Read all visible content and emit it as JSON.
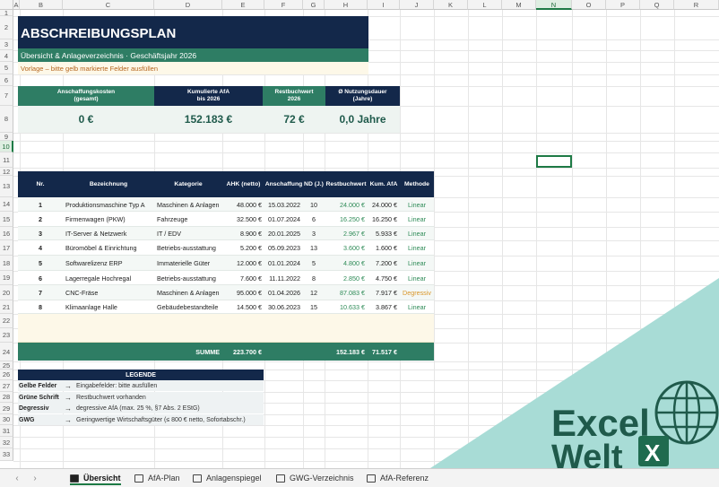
{
  "sheet": {
    "column_letters": [
      "A",
      "B",
      "C",
      "D",
      "E",
      "F",
      "G",
      "H",
      "I",
      "J",
      "K",
      "L",
      "M",
      "N",
      "O",
      "P",
      "Q",
      "R"
    ],
    "row_numbers": [
      "1",
      "2",
      "3",
      "4",
      "5",
      "6",
      "7",
      "8",
      "9",
      "10",
      "11",
      "12",
      "13",
      "14",
      "15",
      "16",
      "17",
      "18",
      "19",
      "20",
      "21",
      "22",
      "23",
      "24",
      "25",
      "26",
      "27",
      "28",
      "29",
      "30",
      "31",
      "32",
      "33"
    ],
    "selected_column": "N",
    "selected_row": "10"
  },
  "header": {
    "title": "ABSCHREIBUNGSPLAN",
    "subtitle": "Übersicht & Anlageverzeichnis  ·  Geschäftsjahr 2026",
    "note": "Vorlage – bitte gelb markierte Felder ausfüllen"
  },
  "kpis": [
    {
      "label": "Anschaffungskosten\n(gesamt)",
      "value": "0 €"
    },
    {
      "label": "Kumulierte AfA\nbis 2026",
      "value": "152.183 €"
    },
    {
      "label": "Restbuchwert\n2026",
      "value": "72 €"
    },
    {
      "label": "Ø Nutzungsdauer\n(Jahre)",
      "value": "0,0 Jahre"
    }
  ],
  "table": {
    "columns": [
      "Nr.",
      "Bezeichnung",
      "Kategorie",
      "AHK (netto)",
      "Anschaffung",
      "ND (J.)",
      "Restbuchwert",
      "Kum. AfA",
      "Methode"
    ],
    "rows": [
      [
        "1",
        "Produktionsmaschine Typ A",
        "Maschinen & Anlagen",
        "48.000 €",
        "15.03.2022",
        "10",
        "24.000 €",
        "24.000 €",
        "Linear"
      ],
      [
        "2",
        "Firmenwagen (PKW)",
        "Fahrzeuge",
        "32.500 €",
        "01.07.2024",
        "6",
        "16.250 €",
        "16.250 €",
        "Linear"
      ],
      [
        "3",
        "IT-Server & Netzwerk",
        "IT / EDV",
        "8.900 €",
        "20.01.2025",
        "3",
        "2.967 €",
        "5.933 €",
        "Linear"
      ],
      [
        "4",
        "Büromöbel & Einrichtung",
        "Betriebs-ausstattung",
        "5.200 €",
        "05.09.2023",
        "13",
        "3.600 €",
        "1.600 €",
        "Linear"
      ],
      [
        "5",
        "Softwarelizenz ERP",
        "Immaterielle Güter",
        "12.000 €",
        "01.01.2024",
        "5",
        "4.800 €",
        "7.200 €",
        "Linear"
      ],
      [
        "6",
        "Lagerregale Hochregal",
        "Betriebs-ausstattung",
        "7.600 €",
        "11.11.2022",
        "8",
        "2.850 €",
        "4.750 €",
        "Linear"
      ],
      [
        "7",
        "CNC-Fräse",
        "Maschinen & Anlagen",
        "95.000 €",
        "01.04.2026",
        "12",
        "87.083 €",
        "7.917 €",
        "Degressiv"
      ],
      [
        "8",
        "Klimaanlage Halle",
        "Gebäudebestandteile",
        "14.500 €",
        "30.06.2023",
        "15",
        "10.633 €",
        "3.867 €",
        "Linear"
      ]
    ],
    "sum_label": "SUMME",
    "sum_ahk": "223.700 €",
    "sum_rest": "152.183 €",
    "sum_afa": "71.517 €"
  },
  "legend": {
    "title": "LEGENDE",
    "arrow": "→",
    "items": [
      {
        "key": "Gelbe Felder",
        "text": "Eingabefelder: bitte ausfüllen"
      },
      {
        "key": "Grüne Schrift",
        "text": "Restbuchwert vorhanden"
      },
      {
        "key": "Degressiv",
        "text": "degressive AfA (max. 25 %, §7 Abs. 2 EStG)"
      },
      {
        "key": "GWG",
        "text": "Geringwertige Wirtschaftsgüter (≤ 800 € netto, Sofortabschr.)"
      }
    ]
  },
  "tabs": [
    {
      "label": "Übersicht",
      "active": true
    },
    {
      "label": "AfA-Plan",
      "active": false
    },
    {
      "label": "Anlagenspiegel",
      "active": false
    },
    {
      "label": "GWG-Verzeichnis",
      "active": false
    },
    {
      "label": "AfA-Referenz",
      "active": false
    }
  ],
  "logo": {
    "line1": "Excel",
    "line2": "Welt",
    "badge": "X"
  },
  "colors": {
    "navy": "#13284a",
    "teal": "#2e7d64",
    "green_text": "#2e8b57",
    "orange_text": "#d9962a",
    "logo_bg": "#a8dcd6",
    "logo_dark": "#1f5a4b"
  }
}
